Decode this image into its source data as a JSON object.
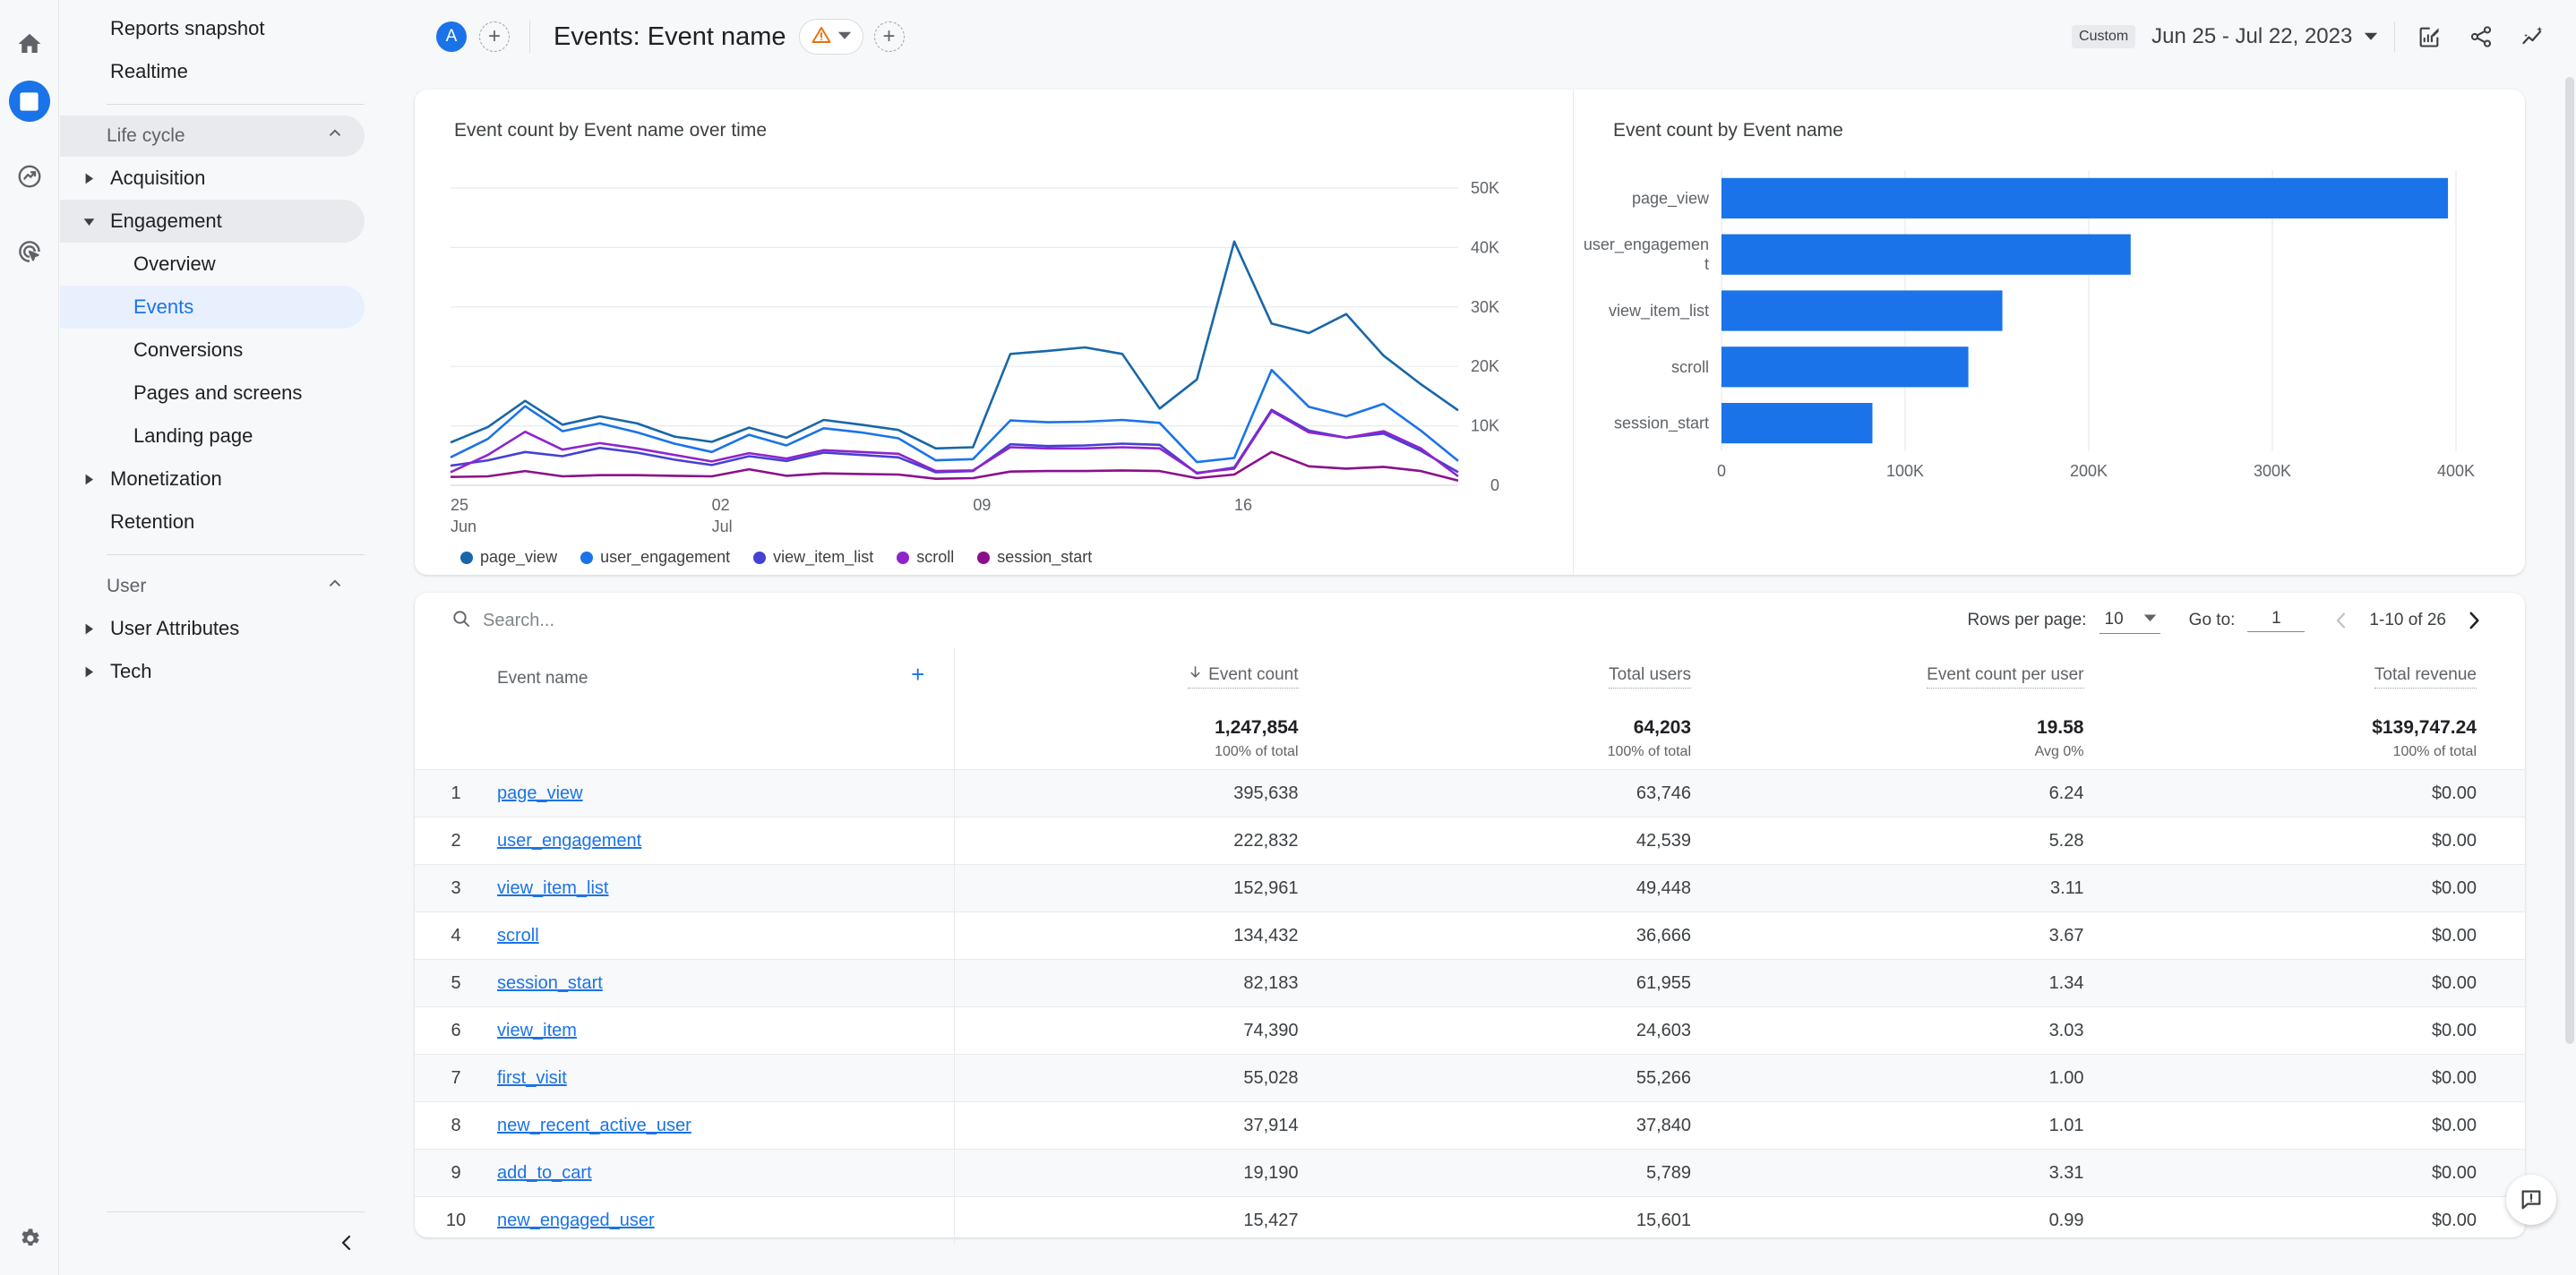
{
  "rail": {
    "items": [
      {
        "name": "home-icon",
        "label": "Home"
      },
      {
        "name": "reports-icon",
        "label": "Reports"
      },
      {
        "name": "explore-icon",
        "label": "Explore"
      },
      {
        "name": "advertising-icon",
        "label": "Advertising"
      }
    ],
    "settings_label": "Admin"
  },
  "sidebar": {
    "top_items": [
      {
        "label": "Reports snapshot"
      },
      {
        "label": "Realtime"
      }
    ],
    "groups": [
      {
        "label": "Life cycle",
        "items": [
          {
            "label": "Acquisition",
            "expandable": true,
            "expanded": false
          },
          {
            "label": "Engagement",
            "expandable": true,
            "expanded": true
          },
          {
            "label": "Overview",
            "sub": true
          },
          {
            "label": "Events",
            "sub": true,
            "selected": true
          },
          {
            "label": "Conversions",
            "sub": true
          },
          {
            "label": "Pages and screens",
            "sub": true
          },
          {
            "label": "Landing page",
            "sub": true
          },
          {
            "label": "Monetization",
            "expandable": true,
            "expanded": false
          },
          {
            "label": "Retention"
          }
        ]
      },
      {
        "label": "User",
        "items": [
          {
            "label": "User Attributes",
            "expandable": true,
            "expanded": false
          },
          {
            "label": "Tech",
            "expandable": true,
            "expanded": false
          }
        ]
      }
    ],
    "collapse_label": "Collapse navigation"
  },
  "topbar": {
    "avatar_letter": "A",
    "add_comparison_label": "+",
    "title": "Events: Event name",
    "warning_label": "Data quality warning",
    "add_filter_label": "+",
    "date_badge": "Custom",
    "date_range": "Jun 25 - Jul 22, 2023",
    "icons": [
      {
        "name": "edit-report-icon",
        "label": "Customize report"
      },
      {
        "name": "share-icon",
        "label": "Share this report"
      },
      {
        "name": "insights-icon",
        "label": "Insights"
      }
    ]
  },
  "charts": {
    "line_title": "Event count by Event name over time",
    "bar_title": "Event count by Event name",
    "legend": [
      {
        "label": "page_view",
        "color": "#1967a8"
      },
      {
        "label": "user_engagement",
        "color": "#1a73e8"
      },
      {
        "label": "view_item_list",
        "color": "#4640d4"
      },
      {
        "label": "scroll",
        "color": "#8e24cc"
      },
      {
        "label": "session_start",
        "color": "#8c0f8c"
      }
    ]
  },
  "chart_data": [
    {
      "type": "line",
      "title": "Event count by Event name over time",
      "xlabel": "",
      "ylabel": "",
      "ylim": [
        0,
        50000
      ],
      "yticks": [
        "0",
        "10K",
        "20K",
        "30K",
        "40K",
        "50K"
      ],
      "xticks": [
        {
          "pos": 0,
          "line1": "25",
          "line2": "Jun"
        },
        {
          "pos": 7,
          "line1": "02",
          "line2": "Jul"
        },
        {
          "pos": 14,
          "line1": "09",
          "line2": ""
        },
        {
          "pos": 21,
          "line1": "16",
          "line2": ""
        }
      ],
      "grid": true,
      "legend_position": "below",
      "x": [
        "Jun 25",
        "Jun 26",
        "Jun 27",
        "Jun 28",
        "Jun 29",
        "Jun 30",
        "Jul 01",
        "Jul 02",
        "Jul 03",
        "Jul 04",
        "Jul 05",
        "Jul 06",
        "Jul 07",
        "Jul 08",
        "Jul 09",
        "Jul 10",
        "Jul 11",
        "Jul 12",
        "Jul 13",
        "Jul 14",
        "Jul 15",
        "Jul 16",
        "Jul 17",
        "Jul 18",
        "Jul 19",
        "Jul 20",
        "Jul 21",
        "Jul 22"
      ],
      "series": [
        {
          "name": "page_view",
          "color": "#1967a8",
          "values": [
            7200,
            9800,
            14200,
            10200,
            11600,
            10400,
            8200,
            7300,
            9700,
            8000,
            11000,
            10200,
            9300,
            6200,
            6400,
            22100,
            22600,
            23200,
            22100,
            12900,
            17800,
            41000,
            27200,
            25600,
            28800,
            21800,
            17000,
            12600
          ]
        },
        {
          "name": "user_engagement",
          "color": "#1a73e8",
          "values": [
            4700,
            7800,
            13300,
            9100,
            10400,
            8900,
            7000,
            5600,
            8500,
            6700,
            9600,
            8900,
            7900,
            4200,
            4400,
            10900,
            10600,
            10700,
            11000,
            10500,
            3900,
            4600,
            19400,
            13200,
            11600,
            13700,
            9200,
            4100
          ]
        },
        {
          "name": "view_item_list",
          "color": "#4640d4",
          "values": [
            3300,
            4200,
            5600,
            4900,
            6300,
            5500,
            4300,
            3400,
            4900,
            4100,
            5500,
            5100,
            4700,
            2200,
            2400,
            6900,
            6600,
            6700,
            7000,
            6800,
            2000,
            3000,
            12700,
            9200,
            8000,
            8700,
            5800,
            2200
          ]
        },
        {
          "name": "scroll",
          "color": "#8e24cc",
          "values": [
            2200,
            5100,
            9000,
            6000,
            7100,
            6200,
            5100,
            4000,
            5400,
            4500,
            5900,
            5600,
            5300,
            2400,
            2500,
            6400,
            6200,
            6200,
            6400,
            6200,
            2100,
            2800,
            12500,
            8900,
            8000,
            9100,
            6200,
            1500
          ]
        },
        {
          "name": "session_start",
          "color": "#8c0f8c",
          "values": [
            1400,
            1500,
            2400,
            1500,
            1700,
            1700,
            1600,
            1500,
            2700,
            1600,
            2000,
            1900,
            1800,
            1100,
            1200,
            2300,
            2400,
            2400,
            2500,
            2400,
            1200,
            1800,
            5600,
            3200,
            2800,
            3100,
            2400,
            800
          ]
        }
      ]
    },
    {
      "type": "bar",
      "orientation": "horizontal",
      "title": "Event count by Event name",
      "xlabel": "",
      "ylabel": "",
      "xlim": [
        0,
        400000
      ],
      "xticks": [
        "0",
        "100K",
        "200K",
        "300K",
        "400K"
      ],
      "grid": true,
      "bar_color": "#1a73e8",
      "categories": [
        "page_view",
        "user_engagement",
        "view_item_list",
        "scroll",
        "session_start"
      ],
      "values": [
        395638,
        222832,
        152961,
        134432,
        82183
      ]
    }
  ],
  "table": {
    "search_placeholder": "Search...",
    "search_value": "",
    "pagination": {
      "rows_label": "Rows per page:",
      "rows_value": "10",
      "goto_label": "Go to:",
      "goto_value": "1",
      "range_label": "1-10 of 26"
    },
    "columns": [
      {
        "label": "Event name",
        "sorted": false
      },
      {
        "label": "Event count",
        "sorted": true,
        "sort_dir": "desc"
      },
      {
        "label": "Total users",
        "sorted": false
      },
      {
        "label": "Event count per user",
        "sorted": false
      },
      {
        "label": "Total revenue",
        "sorted": false
      }
    ],
    "add_dimension_label": "+",
    "totals": [
      {
        "value": "1,247,854",
        "sub": "100% of total"
      },
      {
        "value": "64,203",
        "sub": "100% of total"
      },
      {
        "value": "19.58",
        "sub": "Avg 0%"
      },
      {
        "value": "$139,747.24",
        "sub": "100% of total"
      }
    ],
    "rows": [
      {
        "idx": "1",
        "name": "page_view",
        "event_count": "395,638",
        "total_users": "63,746",
        "per_user": "6.24",
        "revenue": "$0.00"
      },
      {
        "idx": "2",
        "name": "user_engagement",
        "event_count": "222,832",
        "total_users": "42,539",
        "per_user": "5.28",
        "revenue": "$0.00"
      },
      {
        "idx": "3",
        "name": "view_item_list",
        "event_count": "152,961",
        "total_users": "49,448",
        "per_user": "3.11",
        "revenue": "$0.00"
      },
      {
        "idx": "4",
        "name": "scroll",
        "event_count": "134,432",
        "total_users": "36,666",
        "per_user": "3.67",
        "revenue": "$0.00"
      },
      {
        "idx": "5",
        "name": "session_start",
        "event_count": "82,183",
        "total_users": "61,955",
        "per_user": "1.34",
        "revenue": "$0.00"
      },
      {
        "idx": "6",
        "name": "view_item",
        "event_count": "74,390",
        "total_users": "24,603",
        "per_user": "3.03",
        "revenue": "$0.00"
      },
      {
        "idx": "7",
        "name": "first_visit",
        "event_count": "55,028",
        "total_users": "55,266",
        "per_user": "1.00",
        "revenue": "$0.00"
      },
      {
        "idx": "8",
        "name": "new_recent_active_user",
        "event_count": "37,914",
        "total_users": "37,840",
        "per_user": "1.01",
        "revenue": "$0.00"
      },
      {
        "idx": "9",
        "name": "add_to_cart",
        "event_count": "19,190",
        "total_users": "5,789",
        "per_user": "3.31",
        "revenue": "$0.00"
      },
      {
        "idx": "10",
        "name": "new_engaged_user",
        "event_count": "15,427",
        "total_users": "15,601",
        "per_user": "0.99",
        "revenue": "$0.00"
      }
    ]
  },
  "feedback": {
    "label": "Send feedback"
  },
  "colors": {
    "accent": "#1a73e8",
    "selected_bg": "#e8f0fe",
    "warning": "#e8710a"
  }
}
